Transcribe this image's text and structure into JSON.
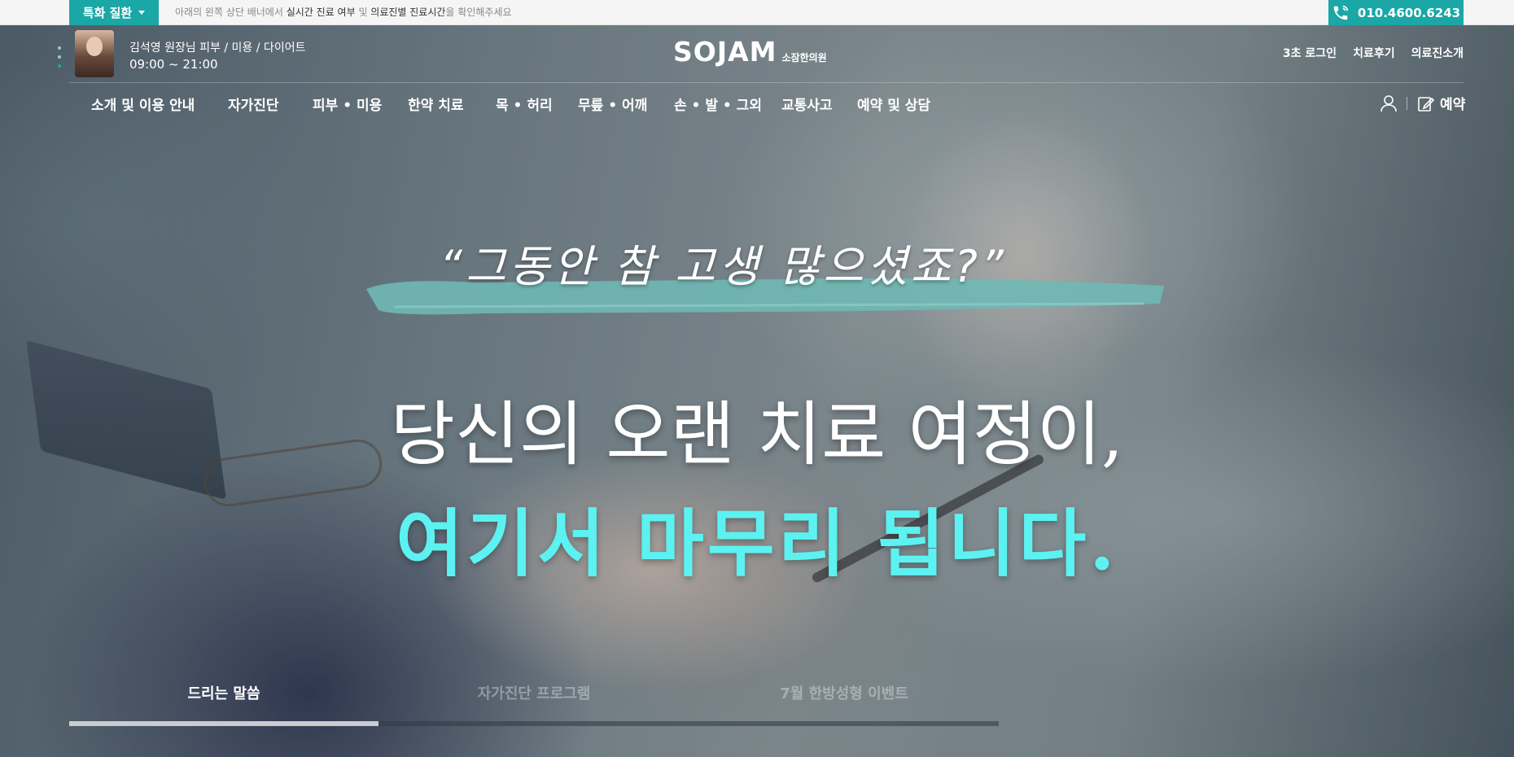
{
  "topbar": {
    "special_label": "특화 질환",
    "notice_prefix": "아래의 왼쪽 상단 배너에서 ",
    "notice_highlight1": "실시간 진료 여부",
    "notice_mid": " 및 ",
    "notice_highlight2": "의료진별 진료시간",
    "notice_suffix": "을 확인해주세요",
    "phone": "010.4600.6243"
  },
  "header": {
    "doctor_name": "김석영 원장님  피부 / 미용 / 다이어트",
    "doctor_hours": "09:00 ~ 21:00",
    "logo_main": "SOJAM",
    "logo_sub": "소잠한의원",
    "links": [
      "3초 로그인",
      "치료후기",
      "의료진소개"
    ]
  },
  "nav": {
    "items": [
      "소개 및 이용 안내",
      "자가진단",
      "피부 • 미용",
      "한약 치료",
      "목 • 허리",
      "무릎 • 어깨",
      "손 • 발 • 그외",
      "교통사고",
      "예약 및 상담"
    ],
    "reserve_label": "예약"
  },
  "hero": {
    "slogan": "“그동안 참 고생 많으셨죠?”",
    "headline1": "당신의 오랜 치료 여정이,",
    "headline2": "여기서 마무리 됩니다.",
    "accent_color": "#5cf2f2",
    "brush_color": "#6fb8b4"
  },
  "slides": {
    "tabs": [
      "드리는 말씀",
      "자가진단 프로그램",
      "7월 한방성형 이벤트"
    ],
    "active_index": 0,
    "progress": 0.333
  },
  "colors": {
    "brand": "#1aa7a6"
  },
  "icons": {
    "phone": "phone-icon",
    "user": "user-icon",
    "reserve": "edit-icon",
    "caret": "caret-down-icon"
  }
}
